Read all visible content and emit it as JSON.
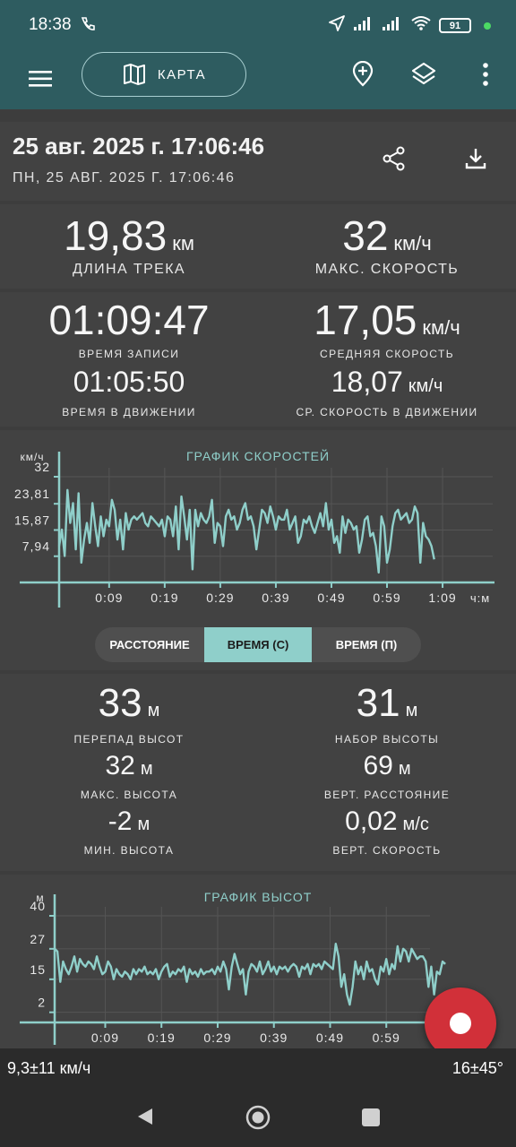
{
  "status_bar": {
    "time": "18:38",
    "battery": "91"
  },
  "app_bar": {
    "map_label": "КАРТА"
  },
  "header": {
    "title": "25 авг. 2025 г. 17:06:46",
    "subtitle": "ПН, 25 АВГ. 2025 Г. 17:06:46"
  },
  "track_stats": {
    "length": {
      "value": "19,83",
      "unit": "км",
      "label": "ДЛИНА ТРЕКА"
    },
    "max_speed": {
      "value": "32",
      "unit": "км/ч",
      "label": "МАКС. СКОРОСТЬ"
    },
    "record_time": {
      "value": "01:09:47",
      "label": "ВРЕМЯ ЗАПИСИ"
    },
    "avg_speed": {
      "value": "17,05",
      "unit": "км/ч",
      "label": "СРЕДНЯЯ СКОРОСТЬ"
    },
    "moving_time": {
      "value": "01:05:50",
      "label": "ВРЕМЯ В ДВИЖЕНИИ"
    },
    "avg_moving_speed": {
      "value": "18,07",
      "unit": "км/ч",
      "label": "СР. СКОРОСТЬ В ДВИЖЕНИИ"
    }
  },
  "speed_chart": {
    "title": "ГРАФИК СКОРОСТЕЙ",
    "y_unit": "км/ч",
    "x_unit": "ч:м",
    "y_ticks": [
      "32",
      "23,81",
      "15,87",
      "7,94"
    ],
    "x_ticks": [
      "0:09",
      "0:19",
      "0:29",
      "0:39",
      "0:49",
      "0:59",
      "1:09"
    ]
  },
  "segmented": {
    "options": [
      "РАССТОЯНИЕ",
      "ВРЕМЯ (С)",
      "ВРЕМЯ (П)"
    ],
    "selected": "ВРЕМЯ (С)"
  },
  "elevation_stats": {
    "elev_diff": {
      "value": "33",
      "unit": "м",
      "label": "ПЕРЕПАД ВЫСОТ"
    },
    "elev_gain": {
      "value": "31",
      "unit": "м",
      "label": "НАБОР ВЫСОТЫ"
    },
    "max_elev": {
      "value": "32",
      "unit": "м",
      "label": "МАКС. ВЫСОТА"
    },
    "vert_dist": {
      "value": "69",
      "unit": "м",
      "label": "ВЕРТ. РАССТОЯНИЕ"
    },
    "min_elev": {
      "value": "-2",
      "unit": "м",
      "label": "МИН. ВЫСОТА"
    },
    "vert_speed": {
      "value": "0,02",
      "unit": "м/с",
      "label": "ВЕРТ. СКОРОСТЬ"
    }
  },
  "elevation_chart": {
    "title": "ГРАФИК ВЫСОТ",
    "y_unit": "м",
    "y_ticks": [
      "40",
      "27",
      "15",
      "2"
    ],
    "x_ticks": [
      "0:09",
      "0:19",
      "0:29",
      "0:39",
      "0:49",
      "0:59"
    ]
  },
  "bottom_info": {
    "left": "9,3±11 км/ч",
    "right": "16±45°"
  },
  "chart_data": [
    {
      "type": "line",
      "title": "ГРАФИК СКОРОСТЕЙ",
      "ylabel": "км/ч",
      "xlabel": "ч:м",
      "ylim": [
        0,
        32
      ],
      "xlim": [
        0,
        69.8
      ],
      "x": [
        0,
        0.5,
        1,
        1.5,
        2,
        2.5,
        3,
        3.5,
        4,
        4.5,
        5,
        5.5,
        6,
        6.5,
        7,
        7.5,
        8,
        8.5,
        9,
        9.5,
        10,
        10.5,
        11,
        11.5,
        12,
        12.5,
        13,
        13.5,
        14,
        14.5,
        15,
        15.5,
        16,
        16.5,
        17,
        17.5,
        18,
        18.5,
        19,
        19.5,
        20,
        20.5,
        21,
        21.5,
        22,
        22.5,
        23,
        23.5,
        24,
        24.5,
        25,
        25.5,
        26,
        26.5,
        27,
        27.5,
        28,
        28.5,
        29,
        29.5,
        30,
        30.5,
        31,
        31.5,
        32,
        32.5,
        33,
        33.5,
        34,
        34.5,
        35,
        35.5,
        36,
        36.5,
        37,
        37.5,
        38,
        38.5,
        39,
        39.5,
        40,
        40.5,
        41,
        41.5,
        42,
        42.5,
        43,
        43.5,
        44,
        44.5,
        45,
        45.5,
        46,
        46.5,
        47,
        47.5,
        48,
        48.5,
        49,
        49.5,
        50,
        50.5,
        51,
        51.5,
        52,
        52.5,
        53,
        53.5,
        54,
        54.5,
        55,
        55.5,
        56,
        56.5,
        57,
        57.5,
        58,
        58.5,
        59,
        59.5,
        60,
        60.5,
        61,
        61.5,
        62,
        62.5,
        63,
        63.5,
        64,
        64.5,
        65,
        65.5,
        66,
        66.5,
        67,
        67.5,
        68,
        68.5,
        69,
        69.5
      ],
      "values": [
        11,
        16,
        8,
        28,
        18,
        24,
        10,
        27,
        6,
        13,
        18,
        12,
        24,
        17,
        11,
        20,
        14,
        19,
        17,
        25,
        22,
        13,
        19,
        10,
        21,
        16,
        19,
        20,
        19,
        20,
        21,
        18,
        17,
        20,
        19,
        18,
        17,
        19,
        14,
        20,
        19,
        14,
        23,
        10,
        26,
        20,
        13,
        22,
        4,
        22,
        17,
        21,
        19,
        18,
        20,
        25,
        12,
        18,
        17,
        11,
        20,
        22,
        19,
        20,
        16,
        18,
        22,
        24,
        19,
        20,
        17,
        10,
        16,
        22,
        21,
        18,
        23,
        20,
        16,
        20,
        19,
        19,
        22,
        16,
        18,
        20,
        12,
        14,
        19,
        18,
        20,
        17,
        15,
        18,
        21,
        17,
        24,
        16,
        19,
        12,
        14,
        9,
        20,
        15,
        19,
        18,
        16,
        17,
        9,
        13,
        19,
        20,
        14,
        15,
        11,
        3,
        20,
        17,
        6,
        10,
        17,
        21,
        22,
        19,
        20,
        21,
        18,
        19,
        23,
        21,
        6,
        18,
        14,
        13,
        11,
        7
      ]
    },
    {
      "type": "line",
      "title": "ГРАФИК ВЫСОТ",
      "ylabel": "м",
      "ylim": [
        -2,
        40
      ],
      "xlim": [
        0,
        69.8
      ],
      "x": [
        0,
        0.5,
        1,
        1.5,
        2,
        2.5,
        3,
        3.5,
        4,
        4.5,
        5,
        5.5,
        6,
        6.5,
        7,
        7.5,
        8,
        8.5,
        9,
        9.5,
        10,
        10.5,
        11,
        11.5,
        12,
        12.5,
        13,
        13.5,
        14,
        14.5,
        15,
        15.5,
        16,
        16.5,
        17,
        17.5,
        18,
        18.5,
        19,
        19.5,
        20,
        20.5,
        21,
        21.5,
        22,
        22.5,
        23,
        23.5,
        24,
        24.5,
        25,
        25.5,
        26,
        26.5,
        27,
        27.5,
        28,
        28.5,
        29,
        29.5,
        30,
        30.5,
        31,
        31.5,
        32,
        32.5,
        33,
        33.5,
        34,
        34.5,
        35,
        35.5,
        36,
        36.5,
        37,
        37.5,
        38,
        38.5,
        39,
        39.5,
        40,
        40.5,
        41,
        41.5,
        42,
        42.5,
        43,
        43.5,
        44,
        44.5,
        45,
        45.5,
        46,
        46.5,
        47,
        47.5,
        48,
        48.5,
        49,
        49.5,
        50,
        50.5,
        51,
        51.5,
        52,
        52.5,
        53,
        53.5,
        54,
        54.5,
        55,
        55.5,
        56,
        56.5,
        57,
        57.5,
        58,
        58.5,
        59,
        59.5,
        60,
        60.5,
        61,
        61.5,
        62,
        62.5,
        63,
        63.5,
        64,
        64.5,
        65,
        65.5,
        66,
        66.5,
        67,
        67.5,
        68,
        68.5,
        69,
        69.5
      ],
      "values": [
        27,
        26,
        14,
        22,
        19,
        17,
        20,
        24,
        18,
        23,
        21,
        20,
        22,
        21,
        19,
        24,
        20,
        17,
        18,
        22,
        20,
        15,
        19,
        17,
        16,
        18,
        17,
        15,
        19,
        17,
        19,
        18,
        20,
        17,
        18,
        17,
        19,
        15,
        18,
        20,
        21,
        16,
        18,
        17,
        19,
        18,
        20,
        14,
        19,
        17,
        18,
        16,
        19,
        17,
        18,
        18,
        19,
        17,
        20,
        18,
        22,
        19,
        11,
        20,
        25,
        21,
        17,
        19,
        9,
        18,
        21,
        20,
        18,
        22,
        17,
        19,
        22,
        18,
        20,
        17,
        20,
        19,
        20,
        18,
        20,
        21,
        20,
        16,
        20,
        19,
        21,
        17,
        21,
        20,
        21,
        19,
        22,
        21,
        20,
        19,
        29,
        24,
        12,
        17,
        9,
        5,
        12,
        22,
        17,
        20,
        15,
        22,
        18,
        19,
        15,
        13,
        20,
        18,
        23,
        17,
        21,
        19,
        28,
        22,
        27,
        26,
        22,
        27,
        25,
        23,
        24,
        24,
        22,
        12,
        20,
        9,
        18,
        17,
        22,
        21
      ]
    }
  ]
}
